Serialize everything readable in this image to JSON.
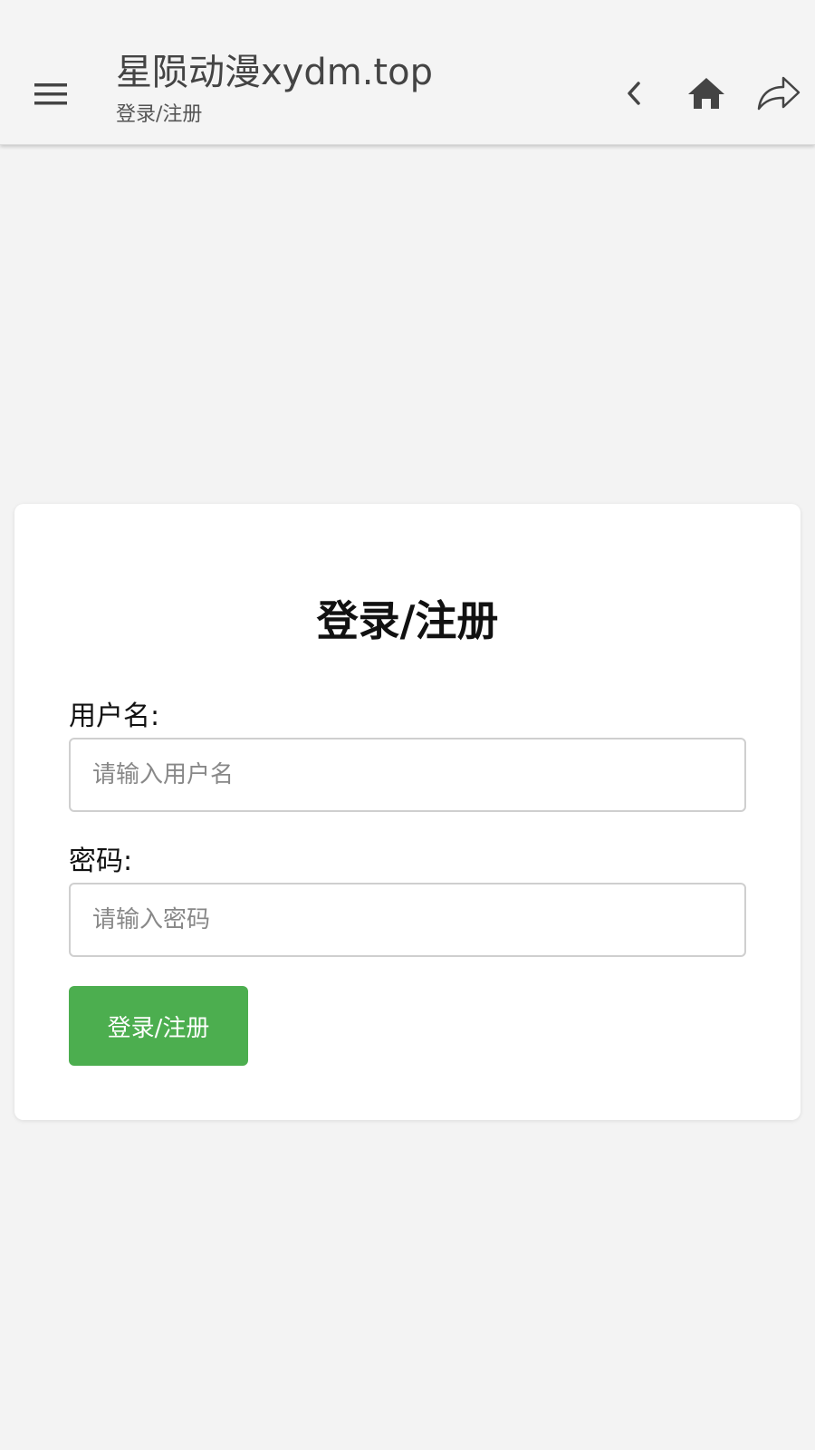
{
  "appbar": {
    "title": "星陨动漫xydm.top",
    "subtitle": "登录/注册",
    "icons": {
      "menu": "menu-icon",
      "back": "chevron-left-icon",
      "home": "home-icon",
      "share": "share-icon"
    }
  },
  "login_card": {
    "title": "登录/注册",
    "username_label": "用户名:",
    "username_placeholder": "请输入用户名",
    "username_value": "",
    "password_label": "密码:",
    "password_placeholder": "请输入密码",
    "password_value": "",
    "submit_label": "登录/注册"
  },
  "colors": {
    "background": "#f3f3f3",
    "appbar": "#f4f4f4",
    "card": "#ffffff",
    "primary_button": "#4cae4f",
    "icon": "#444444"
  }
}
